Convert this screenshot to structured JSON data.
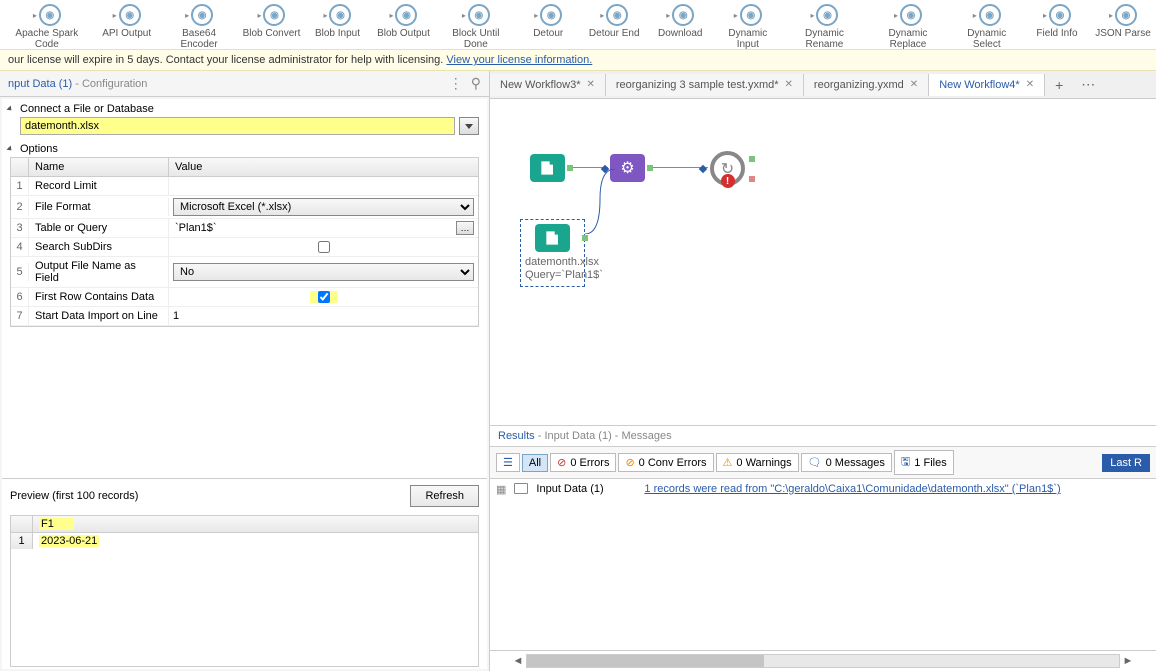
{
  "toolbar": {
    "items": [
      {
        "label": "Apache Spark Code"
      },
      {
        "label": "API Output"
      },
      {
        "label": "Base64 Encoder"
      },
      {
        "label": "Blob Convert"
      },
      {
        "label": "Blob Input"
      },
      {
        "label": "Blob Output"
      },
      {
        "label": "Block Until Done"
      },
      {
        "label": "Detour"
      },
      {
        "label": "Detour End"
      },
      {
        "label": "Download"
      },
      {
        "label": "Dynamic Input"
      },
      {
        "label": "Dynamic Rename"
      },
      {
        "label": "Dynamic Replace"
      },
      {
        "label": "Dynamic Select"
      },
      {
        "label": "Field Info"
      },
      {
        "label": "JSON Parse"
      }
    ]
  },
  "license": {
    "text": "our license will expire in 5 days. Contact your license administrator for help with licensing.  ",
    "link": "View your license information."
  },
  "config": {
    "title": "nput Data (1)",
    "subtitle": " - Configuration",
    "connect_label": "Connect a File or Database",
    "file_value": "datemonth.xlsx",
    "options_label": "Options",
    "col_name": "Name",
    "col_value": "Value",
    "rows": [
      {
        "n": "1",
        "name": "Record Limit",
        "value": ""
      },
      {
        "n": "2",
        "name": "File Format",
        "value": "Microsoft Excel (*.xlsx)"
      },
      {
        "n": "3",
        "name": "Table or Query",
        "value": "`Plan1$`"
      },
      {
        "n": "4",
        "name": "Search SubDirs",
        "checked": false
      },
      {
        "n": "5",
        "name": "Output File Name as Field",
        "value": "No"
      },
      {
        "n": "6",
        "name": "First Row Contains Data",
        "checked": true,
        "highlight": true
      },
      {
        "n": "7",
        "name": "Start Data Import on Line",
        "value": "1"
      }
    ]
  },
  "preview": {
    "label": "Preview (first 100 records)",
    "refresh": "Refresh",
    "header": "F1",
    "row_num": "1",
    "cell": "2023-06-21"
  },
  "tabs": [
    {
      "label": "New Workflow3*",
      "active": false
    },
    {
      "label": "reorganizing 3 sample test.yxmd*",
      "active": false
    },
    {
      "label": "reorganizing.yxmd",
      "active": false
    },
    {
      "label": "New Workflow4*",
      "active": true
    }
  ],
  "canvas": {
    "node_label_line1": "datemonth.xlsx",
    "node_label_line2": "Query=`Plan1$`"
  },
  "results": {
    "title": "Results",
    "subtitle": " - Input Data (1) - Messages",
    "all": "All",
    "errors": "0 Errors",
    "conv": "0 Conv Errors",
    "warnings": "0 Warnings",
    "messages": "0 Messages",
    "files": "1 Files",
    "last_run": "Last R",
    "source": "Input Data (1)",
    "message": "1 records were read from \"C:\\geraldo\\Caixa1\\Comunidade\\datemonth.xlsx\" (`Plan1$`)"
  }
}
